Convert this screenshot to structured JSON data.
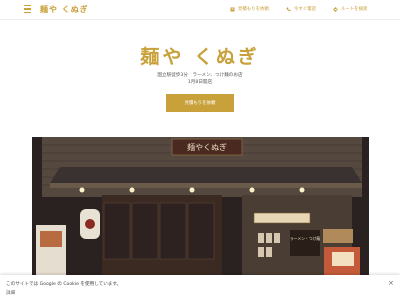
{
  "header": {
    "brand": "麺や くぬぎ",
    "nav": [
      {
        "label": "見積もりを依頼",
        "icon": "receipt-icon"
      },
      {
        "label": "今すぐ電話",
        "icon": "phone-icon"
      },
      {
        "label": "ルートを検索",
        "icon": "directions-icon"
      }
    ]
  },
  "hero": {
    "title": "麺や くぬぎ",
    "line1": "国立駅徒歩3分　ラーメン、つけ麺のお店",
    "line2": "1月8日開店",
    "cta_label": "見積もりを依頼"
  },
  "cookie": {
    "text": "このサイトでは Google の Cookie を使用しています。",
    "details": "詳細",
    "close": "×"
  },
  "colors": {
    "accent": "#c8a13a",
    "awning": "#3a3230",
    "sign_bg": "#4a2a20"
  },
  "photo": {
    "sign_text": "麺やくぬぎ",
    "menu_board": "ラーメン・つけ麺"
  }
}
